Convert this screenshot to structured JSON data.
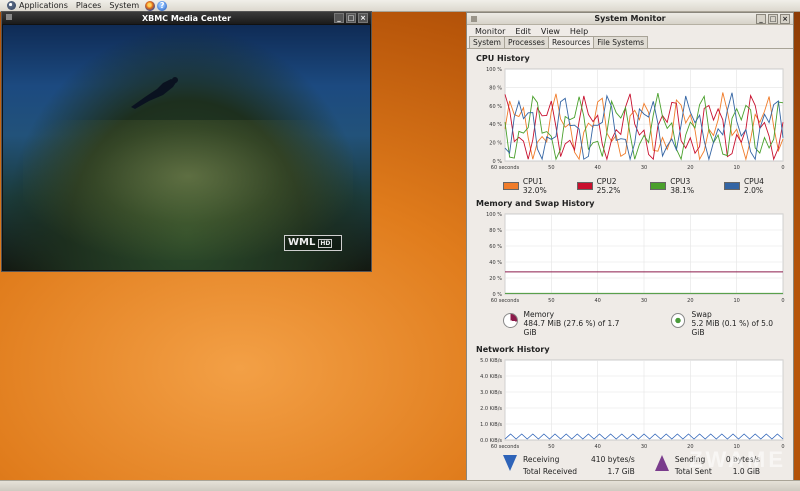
{
  "top_panel": {
    "menus": [
      "Applications",
      "Places",
      "System"
    ]
  },
  "xbmc_window": {
    "title": "XBMC Media Center",
    "logo_text": "WML",
    "logo_badge": "HD"
  },
  "system_monitor": {
    "title": "System Monitor",
    "menu": [
      "Monitor",
      "Edit",
      "View",
      "Help"
    ],
    "tabs": [
      "System",
      "Processes",
      "Resources",
      "File Systems"
    ],
    "active_tab": "Resources",
    "cpu": {
      "section_title": "CPU History",
      "y_ticks": [
        "100 %",
        "80 %",
        "60 %",
        "40 %",
        "20 %",
        "0 %"
      ],
      "x_ticks": [
        "60 seconds",
        "50",
        "40",
        "30",
        "20",
        "10",
        "0"
      ],
      "legend": [
        {
          "label": "CPU1 32.0%",
          "color": "#f07c2a"
        },
        {
          "label": "CPU2 25.2%",
          "color": "#c8102e"
        },
        {
          "label": "CPU3 38.1%",
          "color": "#4aa02c"
        },
        {
          "label": "CPU4 2.0%",
          "color": "#3465a4"
        }
      ]
    },
    "memory": {
      "section_title": "Memory and Swap History",
      "y_ticks": [
        "100 %",
        "80 %",
        "60 %",
        "40 %",
        "20 %",
        "0 %"
      ],
      "x_ticks": [
        "60 seconds",
        "50",
        "40",
        "30",
        "20",
        "10",
        "0"
      ],
      "memory_label": "Memory",
      "memory_value": "484.7 MiB (27.6 %) of 1.7 GiB",
      "swap_label": "Swap",
      "swap_value": "5.2 MiB (0.1 %) of 5.0 GiB",
      "memory_percent": 27.6,
      "swap_percent": 0.1
    },
    "network": {
      "section_title": "Network History",
      "y_ticks": [
        "5.0 KiB/s",
        "4.0 KiB/s",
        "3.0 KiB/s",
        "2.0 KiB/s",
        "1.0 KiB/s",
        "0.0 KiB/s"
      ],
      "x_ticks": [
        "60 seconds",
        "50",
        "40",
        "30",
        "20",
        "10",
        "0"
      ],
      "receiving_label": "Receiving",
      "receiving_value": "410 bytes/s",
      "total_received_label": "Total Received",
      "total_received_value": "1.7 GiB",
      "sending_label": "Sending",
      "sending_value": "0 bytes/s",
      "total_sent_label": "Total Sent",
      "total_sent_value": "1.0 GiB"
    }
  },
  "watermark": {
    "text": "ZWAME"
  },
  "colors": {
    "memory": "#8b1a4a",
    "swap": "#4a9a3a",
    "receiving": "#2e63b8",
    "sending": "#7a3c8c"
  }
}
